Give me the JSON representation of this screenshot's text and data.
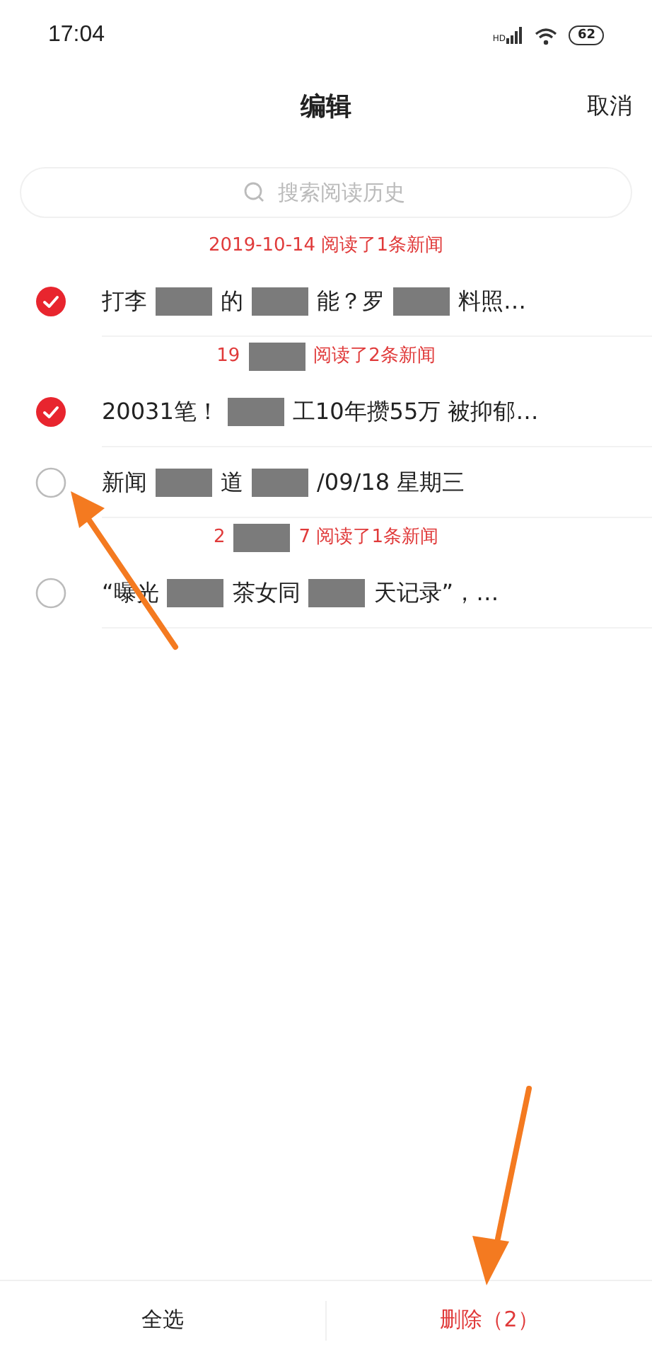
{
  "status_bar": {
    "time": "17:04",
    "network": "HD",
    "battery": "62"
  },
  "header": {
    "title": "编辑",
    "cancel": "取消"
  },
  "search": {
    "placeholder": "搜索阅读历史"
  },
  "groups": [
    {
      "date_parts": [
        "2019-10-14 阅读了1条新闻"
      ],
      "items": [
        {
          "parts": [
            "打李",
            "的",
            "能？罗",
            "料照…"
          ],
          "checked": true
        }
      ]
    },
    {
      "date_parts": [
        "19",
        "阅读了2条新闻"
      ],
      "items": [
        {
          "parts": [
            "20031笔！",
            "工10年攒55万 被抑郁…"
          ],
          "checked": true
        },
        {
          "parts": [
            "新闻",
            "道",
            "/09/18 星期三"
          ],
          "checked": false
        }
      ]
    },
    {
      "date_parts": [
        "2",
        "7 阅读了1条新闻"
      ],
      "items": [
        {
          "parts": [
            "“曝光",
            "茶女同",
            "天记录”，…"
          ],
          "checked": false
        }
      ]
    }
  ],
  "bottom_bar": {
    "select_all": "全选",
    "delete": "删除（2）"
  }
}
